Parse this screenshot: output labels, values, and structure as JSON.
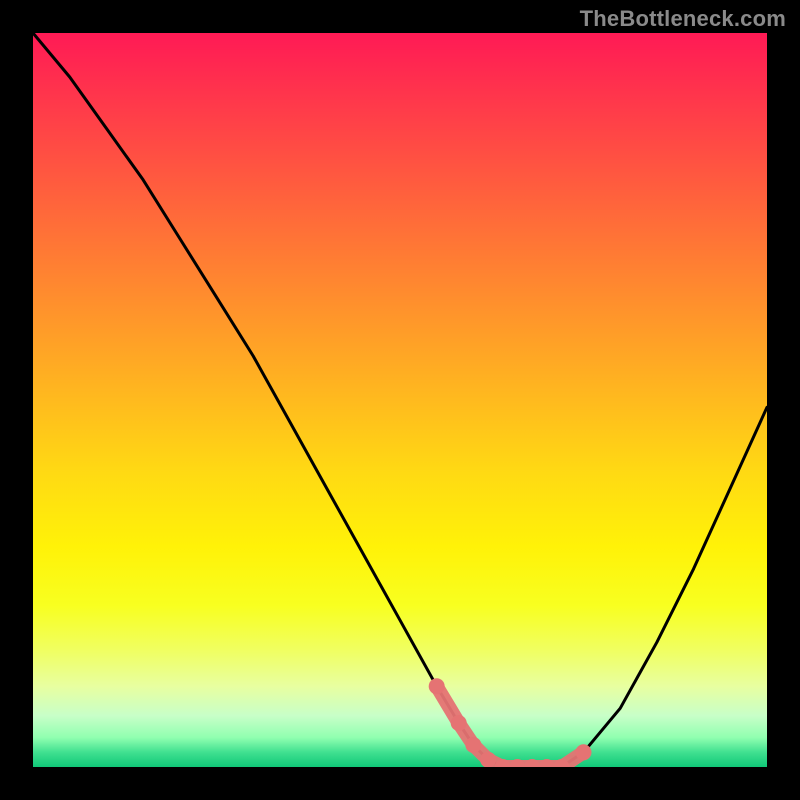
{
  "watermark": "TheBottleneck.com",
  "colors": {
    "background": "#000000",
    "curve": "#000000",
    "marker": "#e57373",
    "watermark": "#8a8a8a"
  },
  "chart_data": {
    "type": "line",
    "title": "",
    "xlabel": "",
    "ylabel": "",
    "xlim": [
      0,
      100
    ],
    "ylim": [
      0,
      100
    ],
    "grid": false,
    "legend": false,
    "series": [
      {
        "name": "bottleneck-curve",
        "x": [
          0,
          5,
          10,
          15,
          20,
          25,
          30,
          35,
          40,
          45,
          50,
          55,
          58,
          60,
          62,
          64,
          66,
          68,
          70,
          72,
          75,
          80,
          85,
          90,
          95,
          100
        ],
        "values": [
          100,
          94,
          87,
          80,
          72,
          64,
          56,
          47,
          38,
          29,
          20,
          11,
          6,
          3,
          1,
          0,
          0,
          0,
          0,
          0,
          2,
          8,
          17,
          27,
          38,
          49
        ]
      }
    ],
    "marker_region": {
      "x": [
        55,
        58,
        60,
        62,
        64,
        66,
        68,
        70,
        72,
        75
      ],
      "values": [
        11,
        6,
        3,
        1,
        0,
        0,
        0,
        0,
        0,
        2
      ]
    },
    "gradient_stops": [
      {
        "offset": 0,
        "color": "#ff1a55"
      },
      {
        "offset": 50,
        "color": "#ffda13"
      },
      {
        "offset": 78,
        "color": "#f8ff20"
      },
      {
        "offset": 93,
        "color": "#c8ffc8"
      },
      {
        "offset": 100,
        "color": "#10c878"
      }
    ]
  }
}
